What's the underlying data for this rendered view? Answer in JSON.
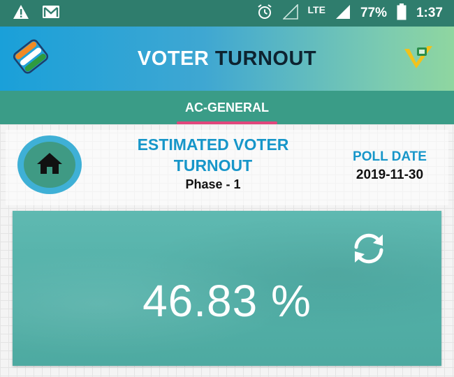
{
  "status_bar": {
    "battery": "77%",
    "time": "1:37",
    "network": "LTE",
    "icons": [
      "warning-icon",
      "gmail-icon",
      "alarm-icon",
      "signal-icon",
      "battery-icon"
    ]
  },
  "app_bar": {
    "title_part1": "VOTER",
    "title_part2": "TURNOUT",
    "colors": {
      "title_dark": "#0d2330",
      "gradient_start": "#1aa0d9",
      "gradient_end": "#8fd6a0"
    }
  },
  "tabs": [
    {
      "label": "AC-GENERAL",
      "selected": true
    }
  ],
  "summary": {
    "heading": "ESTIMATED VOTER TURNOUT",
    "phase": "Phase - 1",
    "poll_date_label": "POLL DATE",
    "poll_date": "2019-11-30"
  },
  "turnout": {
    "value": "46.83 %"
  },
  "colors": {
    "accent_blue": "#1796c9",
    "tab_bar": "#3a9c87",
    "tab_indicator": "#e0457b",
    "card": "#52b0a8"
  }
}
